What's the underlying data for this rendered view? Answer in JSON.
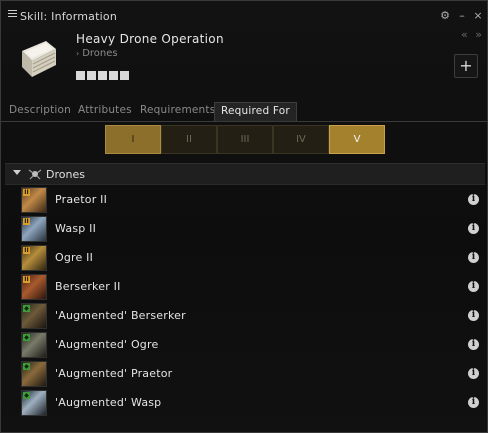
{
  "window": {
    "title": "Skill: Information",
    "controls": {
      "settings": "⚙",
      "minimize": "–",
      "close": "×"
    }
  },
  "header": {
    "skill_name": "Heavy Drone Operation",
    "group_arrow": "›",
    "group": "Drones",
    "trained_levels": 0,
    "total_levels": 5,
    "nav_arrows": "« »",
    "add_button": "+"
  },
  "tabs": [
    {
      "label": "Description"
    },
    {
      "label": "Attributes"
    },
    {
      "label": "Requirements"
    },
    {
      "label": "Required For",
      "active": true
    }
  ],
  "level_selector": {
    "levels": [
      "I",
      "II",
      "III",
      "IV",
      "V"
    ],
    "selected": "V"
  },
  "list": {
    "group_label": "Drones",
    "items": [
      {
        "name": "Praetor II",
        "badge": "II"
      },
      {
        "name": "Wasp II",
        "badge": "II"
      },
      {
        "name": "Ogre II",
        "badge": "II"
      },
      {
        "name": "Berserker II",
        "badge": "II"
      },
      {
        "name": "'Augmented' Berserker",
        "badge": "◆"
      },
      {
        "name": "'Augmented' Ogre",
        "badge": "◆"
      },
      {
        "name": "'Augmented' Praetor",
        "badge": "◆"
      },
      {
        "name": "'Augmented' Wasp",
        "badge": "◆"
      }
    ],
    "info_glyph": "i"
  },
  "colors": {
    "accent_gold": "#a4812d",
    "tech2_badge": "#d8a02a",
    "faction_badge": "#3e9a3a"
  }
}
